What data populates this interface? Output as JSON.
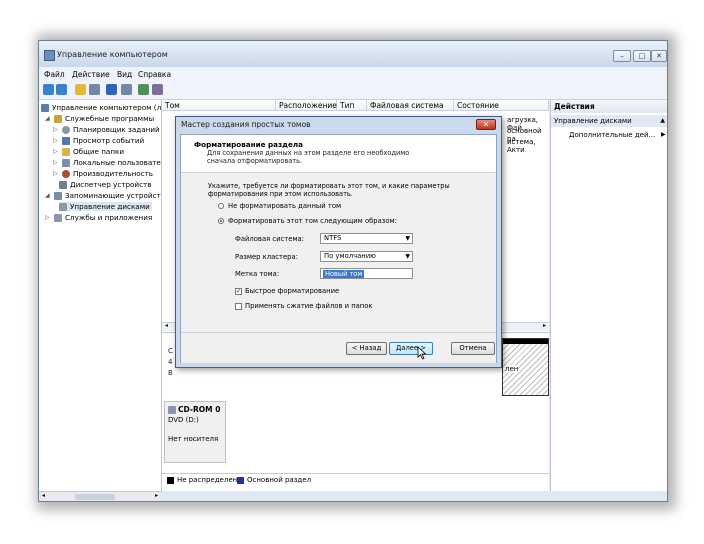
{
  "window": {
    "title": "Управление компьютером"
  },
  "menu": [
    "Файл",
    "Действие",
    "Вид",
    "Справка"
  ],
  "tree": {
    "root": "Управление компьютером (л",
    "items": [
      "Служебные программы",
      "Планировщик заданий",
      "Просмотр событий",
      "Общие папки",
      "Локальные пользовате",
      "Производительность",
      "Диспетчер устройств",
      "Запоминающие устройст",
      "Управление дисками",
      "Службы и приложения"
    ]
  },
  "columns": [
    "Том",
    "Расположение",
    "Тип",
    "Файловая система",
    "Состояние"
  ],
  "row_fragments": [
    "агрузка, Фай",
    "основной ра",
    "истема, Акти"
  ],
  "cdrom": {
    "name": "CD-ROM 0",
    "drive": "DVD (D:)",
    "status": "Нет носителя"
  },
  "legend": {
    "unallocated": "Не распределен",
    "primary": "Основной раздел"
  },
  "partition_fragment": "лен",
  "actions": {
    "header": "Действия",
    "section": "Управление дисками",
    "more": "Дополнительные дей..."
  },
  "dialog": {
    "title": "Мастер создания простых томов",
    "header_title": "Форматирование раздела",
    "header_desc": "Для сохранения данных на этом разделе его необходимо сначала отформатировать.",
    "prompt": "Укажите, требуется ли форматировать этот том, и какие параметры форматирования при этом использовать.",
    "option_no": "Не форматировать данный том",
    "option_yes": "Форматировать этот том следующим образом:",
    "fs_label": "Файловая система:",
    "fs_value": "NTFS",
    "cluster_label": "Размер кластера:",
    "cluster_value": "По умолчанию",
    "volume_label": "Метка тома:",
    "volume_value": "Новый том",
    "quick_format": "Быстрое форматирование",
    "compress": "Применять сжатие файлов и папок",
    "back": "< Назад",
    "next": "Далее >",
    "cancel": "Отмена"
  },
  "colors": {
    "unallocated": "#000000",
    "primary": "#1f2fb0",
    "accent": "#3c78d0"
  },
  "icons": [
    "app-icon",
    "back-icon",
    "forward-icon",
    "folder-icon",
    "close-icon",
    "cursor-icon"
  ]
}
